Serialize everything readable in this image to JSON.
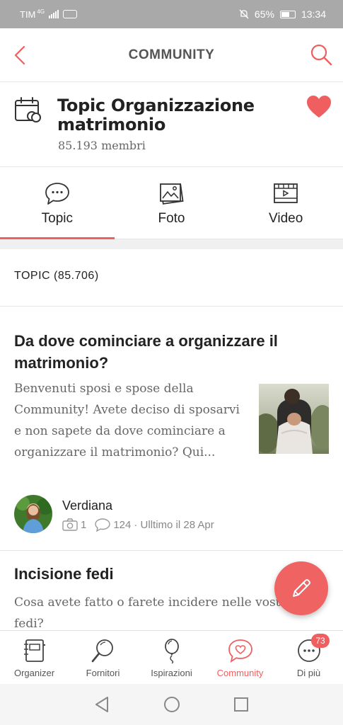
{
  "status_bar": {
    "carrier": "TIM",
    "network": "4G",
    "battery": "65%",
    "time": "13:34"
  },
  "header": {
    "title": "COMMUNITY",
    "back_icon": "chevron-left-icon",
    "search_icon": "search-icon"
  },
  "group": {
    "title": "Topic Organizzazione matrimonio",
    "members": "85.193 membri",
    "icon": "calendar-rings-icon",
    "favorite_icon": "heart-icon"
  },
  "tabs": [
    {
      "label": "Topic",
      "icon": "chat-bubble-icon",
      "active": true
    },
    {
      "label": "Foto",
      "icon": "photo-icon",
      "active": false
    },
    {
      "label": "Video",
      "icon": "film-icon",
      "active": false
    }
  ],
  "topics_header": {
    "label": "TOPIC (85.706)"
  },
  "topic1": {
    "title": "Da dove cominciare a organizzare il matrimonio?",
    "excerpt": "Benvenuti sposi e spose della Community! Avete deciso di sposarvi e non sapete da dove cominciare a organizzare il matrimonio? Qui...",
    "author": "Verdiana",
    "photos": "1",
    "comments": "124",
    "last": "· Ulltimo il 28 Apr"
  },
  "topic2": {
    "title": "Incisione fedi",
    "excerpt": "Cosa avete fatto o farete incidere nelle vostre fedi?"
  },
  "fab": {
    "icon": "pencil-icon"
  },
  "bottom_nav": [
    {
      "label": "Organizer",
      "icon": "notebook-icon"
    },
    {
      "label": "Fornitori",
      "icon": "magnifier-icon"
    },
    {
      "label": "Ispirazioni",
      "icon": "balloon-icon"
    },
    {
      "label": "Community",
      "icon": "chat-heart-icon",
      "active": true
    },
    {
      "label": "Di più",
      "icon": "more-icon",
      "badge": "73"
    }
  ],
  "colors": {
    "accent": "#ef5f5f",
    "status_bar": "#a9a9a9"
  }
}
